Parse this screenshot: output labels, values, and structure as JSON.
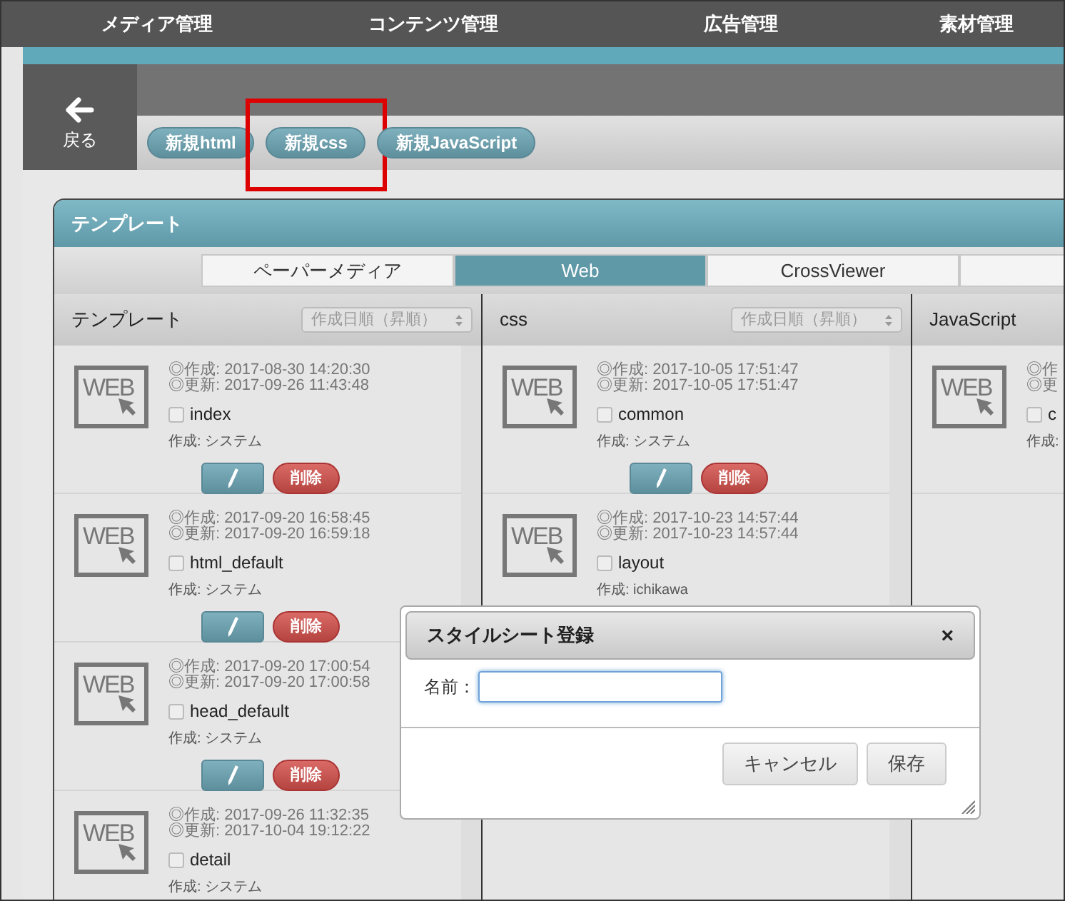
{
  "nav": [
    {
      "label": "メディア管理"
    },
    {
      "label": "コンテンツ管理"
    },
    {
      "label": "広告管理"
    },
    {
      "label": "素材管理"
    }
  ],
  "back_button": {
    "label": "戻る"
  },
  "toolbar_buttons": [
    {
      "label": "新規html",
      "highlighted": false
    },
    {
      "label": "新規css",
      "highlighted": true
    },
    {
      "label": "新規JavaScript",
      "highlighted": false
    }
  ],
  "panel": {
    "title": "テンプレート",
    "tabs": [
      {
        "label": "ペーパーメディア",
        "selected": false
      },
      {
        "label": "Web",
        "selected": true
      },
      {
        "label": "CrossViewer",
        "selected": false
      },
      {
        "selected": false
      }
    ],
    "columns": [
      {
        "title": "テンプレート",
        "sort": "作成日順（昇順）",
        "items": [
          {
            "icon_label": "WEB",
            "created": "◎作成: 2017-08-30 14:20:30",
            "updated": "◎更新: 2017-09-26 11:43:48",
            "name": "index",
            "checked": false,
            "author": "作成: システム",
            "delete": "削除"
          },
          {
            "icon_label": "WEB",
            "created": "◎作成: 2017-09-20 16:58:45",
            "updated": "◎更新: 2017-09-20 16:59:18",
            "name": "html_default",
            "checked": false,
            "author": "作成: システム",
            "delete": "削除"
          },
          {
            "icon_label": "WEB",
            "created": "◎作成: 2017-09-20 17:00:54",
            "updated": "◎更新: 2017-09-20 17:00:58",
            "name": "head_default",
            "checked": false,
            "author": "作成: システム",
            "delete": "削除"
          },
          {
            "icon_label": "WEB",
            "created": "◎作成: 2017-09-26 11:32:35",
            "updated": "◎更新: 2017-10-04 19:12:22",
            "name": "detail",
            "checked": false,
            "author": "作成: システム"
          }
        ]
      },
      {
        "title": "css",
        "sort": "作成日順（昇順）",
        "items": [
          {
            "icon_label": "WEB",
            "created": "◎作成: 2017-10-05 17:51:47",
            "updated": "◎更新: 2017-10-05 17:51:47",
            "name": "common",
            "checked": false,
            "author": "作成: システム",
            "delete": "削除"
          },
          {
            "icon_label": "WEB",
            "created": "◎作成: 2017-10-23 14:57:44",
            "updated": "◎更新: 2017-10-23 14:57:44",
            "name": "layout",
            "checked": false,
            "author": "作成: ichikawa"
          }
        ]
      },
      {
        "title": "JavaScript",
        "items": [
          {
            "icon_label": "WEB",
            "created": "◎作",
            "updated": "◎更",
            "name": "c",
            "checked": false,
            "author": "作成:"
          }
        ]
      }
    ]
  },
  "dialog": {
    "title": "スタイルシート登録",
    "close": "×",
    "field_label": "名前：",
    "buttons": [
      {
        "label": "キャンセル"
      },
      {
        "label": "保存"
      }
    ]
  }
}
